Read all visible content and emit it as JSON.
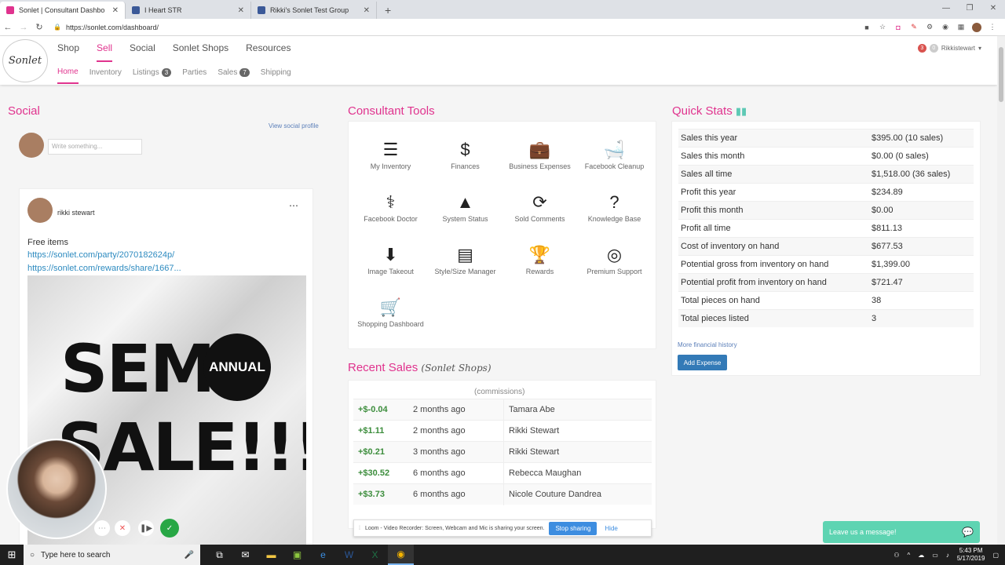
{
  "browser": {
    "tabs": [
      {
        "title": "Sonlet | Consultant Dashbo",
        "color": "#e0338e"
      },
      {
        "title": "I Heart STR",
        "color": "#3b5998"
      },
      {
        "title": "Rikki's Sonlet Test Group",
        "color": "#3b5998"
      }
    ],
    "url": "https://sonlet.com/dashboard/"
  },
  "header": {
    "logo_text": "Sonlet",
    "main_nav": [
      "Shop",
      "Sell",
      "Social",
      "Sonlet Shops",
      "Resources"
    ],
    "sub_nav": [
      {
        "label": "Home",
        "badge": ""
      },
      {
        "label": "Inventory",
        "badge": ""
      },
      {
        "label": "Listings",
        "badge": "3"
      },
      {
        "label": "Parties",
        "badge": ""
      },
      {
        "label": "Sales",
        "badge": "7"
      },
      {
        "label": "Shipping",
        "badge": ""
      }
    ],
    "notif_count": "3",
    "msg_count": "0",
    "username": "Rikkistewart"
  },
  "social": {
    "title": "Social",
    "view_profile": "View social profile",
    "write_placeholder": "Write something...",
    "post": {
      "author": "rikki stewart",
      "text": "Free items",
      "links": [
        "https://sonlet.com/party/2070182624p/",
        "https://sonlet.com/rewards/share/1667..."
      ],
      "image_text_1": "SEMI",
      "image_text_2": "SALE!!!",
      "image_badge": "ANNUAL"
    }
  },
  "tools": {
    "title": "Consultant Tools",
    "items": [
      {
        "label": "My Inventory",
        "icon": "☰"
      },
      {
        "label": "Finances",
        "icon": "$"
      },
      {
        "label": "Business Expenses",
        "icon": "💼"
      },
      {
        "label": "Facebook Cleanup",
        "icon": "🛁"
      },
      {
        "label": "Facebook Doctor",
        "icon": "⚕"
      },
      {
        "label": "System Status",
        "icon": "▲"
      },
      {
        "label": "Sold Comments",
        "icon": "⟳"
      },
      {
        "label": "Knowledge Base",
        "icon": "?"
      },
      {
        "label": "Image Takeout",
        "icon": "⬇"
      },
      {
        "label": "Style/Size Manager",
        "icon": "▤"
      },
      {
        "label": "Rewards",
        "icon": "🏆"
      },
      {
        "label": "Premium Support",
        "icon": "◎"
      },
      {
        "label": "Shopping Dashboard",
        "icon": "🛒"
      }
    ]
  },
  "recent_sales": {
    "title": "Recent Sales",
    "subtitle": "(Sonlet Shops)",
    "commissions": "(commissions)",
    "rows": [
      {
        "amount": "+$-0.04",
        "when": "2 months ago",
        "who": "Tamara Abe"
      },
      {
        "amount": "+$1.11",
        "when": "2 months ago",
        "who": "Rikki Stewart"
      },
      {
        "amount": "+$0.21",
        "when": "3 months ago",
        "who": "Rikki Stewart"
      },
      {
        "amount": "+$30.52",
        "when": "6 months ago",
        "who": "Rebecca Maughan"
      },
      {
        "amount": "+$3.73",
        "when": "6 months ago",
        "who": "Nicole Couture Dandrea"
      }
    ]
  },
  "quick_stats": {
    "title": "Quick Stats",
    "rows": [
      {
        "label": "Sales this year",
        "value": "$395.00 (10 sales)"
      },
      {
        "label": "Sales this month",
        "value": "$0.00 (0 sales)"
      },
      {
        "label": "Sales all time",
        "value": "$1,518.00 (36 sales)"
      },
      {
        "label": "Profit this year",
        "value": "$234.89"
      },
      {
        "label": "Profit this month",
        "value": "$0.00"
      },
      {
        "label": "Profit all time",
        "value": "$811.13"
      },
      {
        "label": "Cost of inventory on hand",
        "value": "$677.53"
      },
      {
        "label": "Potential gross from inventory on hand",
        "value": "$1,399.00"
      },
      {
        "label": "Potential profit from inventory on hand",
        "value": "$721.47"
      },
      {
        "label": "Total pieces on hand",
        "value": "38"
      },
      {
        "label": "Total pieces listed",
        "value": "3"
      }
    ],
    "more_history": "More financial history",
    "add_expense": "Add Expense"
  },
  "loom": {
    "message": "Loom - Video Recorder: Screen, Webcam and Mic is sharing your screen.",
    "stop": "Stop sharing",
    "hide": "Hide"
  },
  "chat": {
    "label": "Leave us a message!"
  },
  "taskbar": {
    "search_placeholder": "Type here to search",
    "time": "5:43 PM",
    "date": "5/17/2019"
  }
}
